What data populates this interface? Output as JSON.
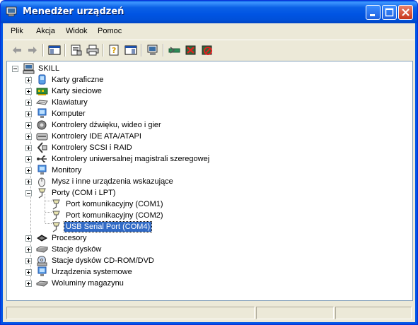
{
  "window": {
    "title": "Menedżer urządzeń"
  },
  "menu": [
    "Plik",
    "Akcja",
    "Widok",
    "Pomoc"
  ],
  "toolbar": {
    "icons": [
      "back-icon",
      "forward-icon",
      "show-hide-console-tree-icon",
      "properties-icon",
      "print-icon",
      "help-icon",
      "show-hide-action-pane-icon",
      "scan-hardware-icon",
      "update-driver-icon",
      "uninstall-icon",
      "disable-icon"
    ]
  },
  "tree": {
    "root": "SKILL",
    "categories": [
      {
        "label": "Karty graficzne",
        "icon": "display-adapter-icon"
      },
      {
        "label": "Karty sieciowe",
        "icon": "network-adapter-icon"
      },
      {
        "label": "Klawiatury",
        "icon": "keyboard-icon"
      },
      {
        "label": "Komputer",
        "icon": "computer-icon"
      },
      {
        "label": "Kontrolery dźwięku, wideo i gier",
        "icon": "sound-icon"
      },
      {
        "label": "Kontrolery IDE ATA/ATAPI",
        "icon": "ide-controller-icon"
      },
      {
        "label": "Kontrolery SCSI i RAID",
        "icon": "scsi-controller-icon"
      },
      {
        "label": "Kontrolery uniwersalnej magistrali szeregowej",
        "icon": "usb-icon"
      },
      {
        "label": "Monitory",
        "icon": "monitor-icon"
      },
      {
        "label": "Mysz i inne urządzenia wskazujące",
        "icon": "mouse-icon"
      },
      {
        "label": "Porty (COM i LPT)",
        "icon": "port-icon",
        "expanded": true,
        "children": [
          {
            "label": "Port komunikacyjny (COM1)",
            "icon": "port-icon"
          },
          {
            "label": "Port komunikacyjny (COM2)",
            "icon": "port-icon"
          },
          {
            "label": "USB Serial Port (COM4)",
            "icon": "port-icon",
            "selected": true
          }
        ]
      },
      {
        "label": "Procesory",
        "icon": "processor-icon"
      },
      {
        "label": "Stacje dysków",
        "icon": "disk-drive-icon"
      },
      {
        "label": "Stacje dysków CD-ROM/DVD",
        "icon": "cdrom-icon"
      },
      {
        "label": "Urządzenia systemowe",
        "icon": "system-devices-icon"
      },
      {
        "label": "Woluminy magazynu",
        "icon": "storage-volume-icon"
      }
    ]
  }
}
